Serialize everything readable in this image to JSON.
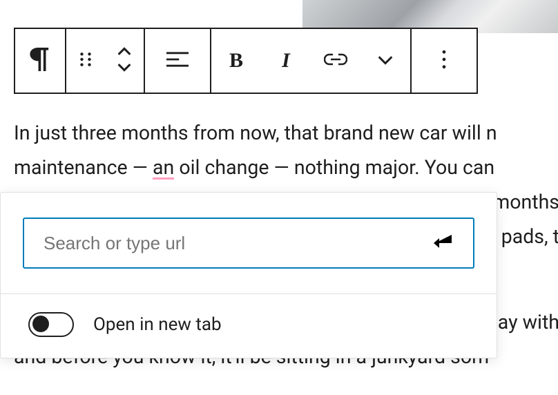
{
  "toolbar": {
    "paragraph_icon": "paragraph",
    "drag_icon": "drag-handle",
    "move_icon": "move-up-down",
    "align_icon": "align-left",
    "bold_label": "B",
    "italic_label": "I",
    "link_icon": "link",
    "more_format_icon": "chevron-down",
    "options_icon": "more-vertical"
  },
  "content": {
    "line1a": "In just three months from now, that brand new car will n",
    "line2a": "maintenance — ",
    "line2_spell": "an",
    "line2b": " oil change — nothing major. You can",
    "line3_tail": "months",
    "line4_tail": "pads, t",
    "line5_tail": "ay with",
    "line6": "and before you know it, it'll be sitting in a junkyard som"
  },
  "link_popover": {
    "placeholder": "Search or type url",
    "value": "",
    "open_new_tab_label": "Open in new tab",
    "open_new_tab": false
  }
}
